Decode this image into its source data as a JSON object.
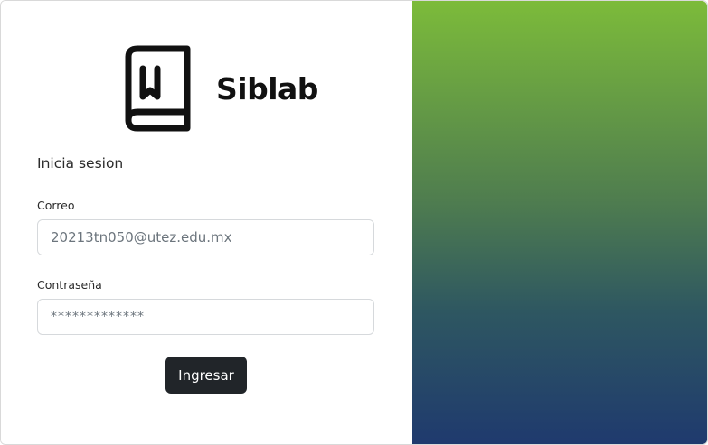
{
  "brand": {
    "name": "Siblab",
    "logo_icon": "book-icon"
  },
  "form": {
    "heading": "Inicia sesion",
    "email": {
      "label": "Correo",
      "value": "20213tn050@utez.edu.mx"
    },
    "password": {
      "label": "Contraseña",
      "value": "*************"
    },
    "submit_label": "Ingresar"
  },
  "colors": {
    "gradient_top": "#7cbb3a",
    "gradient_bottom": "#1f3a6e",
    "button_bg": "#212529",
    "button_text": "#ffffff"
  }
}
